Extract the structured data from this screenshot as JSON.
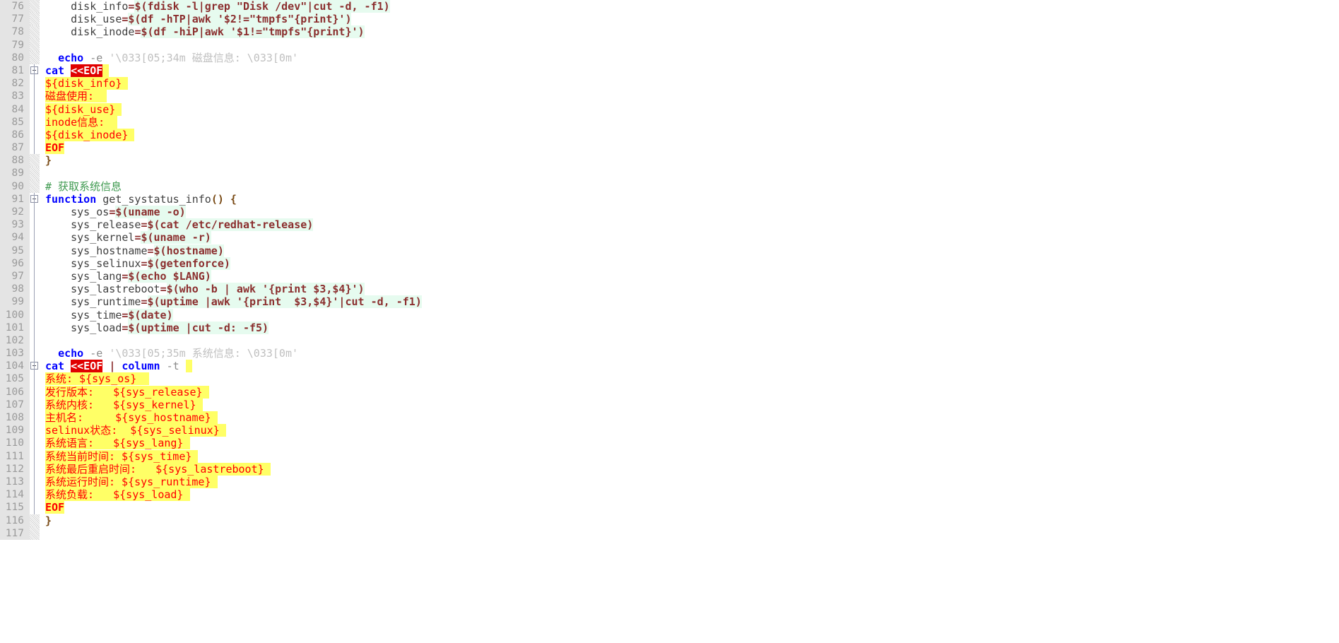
{
  "editor": {
    "app": "code-editor",
    "language": "Bash",
    "first_line": 76,
    "last_line": 117,
    "gutter_bg": "#e4e4e4",
    "gutter_fg": "#9a9a9a",
    "colors": {
      "keyword": "#0000ff",
      "operator": "#8b2e2e",
      "comment": "#3f9a50",
      "string": "#c0c0c0",
      "substitution_bg": "#e6fbef",
      "heredoc_bg": "#ffff66",
      "heredoc_fg": "#ff0000",
      "eof_marker_bg": "#e00000",
      "eof_marker_fg": "#ffffff",
      "text": "#404040"
    }
  },
  "lines": [
    {
      "n": 76,
      "fold": "hatch",
      "text": "    disk_info=$(fdisk -l|grep \"Disk /dev\"|cut -d, -f1)"
    },
    {
      "n": 77,
      "fold": "hatch",
      "text": "    disk_use=$(df -hTP|awk '$2!=\"tmpfs\"{print}')"
    },
    {
      "n": 78,
      "fold": "hatch",
      "text": "    disk_inode=$(df -hiP|awk '$1!=\"tmpfs\"{print}')"
    },
    {
      "n": 79,
      "fold": "hatch",
      "text": ""
    },
    {
      "n": 80,
      "fold": "hatch",
      "text": "  echo -e '\\033[05;34m 磁盘信息: \\033[0m'"
    },
    {
      "n": 81,
      "fold": "box",
      "text": "cat <<EOF"
    },
    {
      "n": 82,
      "fold": "guide",
      "text": "${disk_info}"
    },
    {
      "n": 83,
      "fold": "guide",
      "text": "磁盘使用:"
    },
    {
      "n": 84,
      "fold": "guide",
      "text": "${disk_use}"
    },
    {
      "n": 85,
      "fold": "guide",
      "text": "inode信息:"
    },
    {
      "n": 86,
      "fold": "guide",
      "text": "${disk_inode}"
    },
    {
      "n": 87,
      "fold": "guide",
      "text": "EOF"
    },
    {
      "n": 88,
      "fold": "hatch",
      "text": "}"
    },
    {
      "n": 89,
      "fold": "hatch",
      "text": ""
    },
    {
      "n": 90,
      "fold": "hatch",
      "text": "# 获取系统信息"
    },
    {
      "n": 91,
      "fold": "box",
      "text": "function get_systatus_info() {"
    },
    {
      "n": 92,
      "fold": "guide",
      "text": "    sys_os=$(uname -o)"
    },
    {
      "n": 93,
      "fold": "guide",
      "text": "    sys_release=$(cat /etc/redhat-release)"
    },
    {
      "n": 94,
      "fold": "guide",
      "text": "    sys_kernel=$(uname -r)"
    },
    {
      "n": 95,
      "fold": "guide",
      "text": "    sys_hostname=$(hostname)"
    },
    {
      "n": 96,
      "fold": "guide",
      "text": "    sys_selinux=$(getenforce)"
    },
    {
      "n": 97,
      "fold": "guide",
      "text": "    sys_lang=$(echo $LANG)"
    },
    {
      "n": 98,
      "fold": "guide",
      "text": "    sys_lastreboot=$(who -b | awk '{print $3,$4}')"
    },
    {
      "n": 99,
      "fold": "guide",
      "text": "    sys_runtime=$(uptime |awk '{print  $3,$4}'|cut -d, -f1)"
    },
    {
      "n": 100,
      "fold": "guide",
      "text": "    sys_time=$(date)"
    },
    {
      "n": 101,
      "fold": "guide",
      "text": "    sys_load=$(uptime |cut -d: -f5)"
    },
    {
      "n": 102,
      "fold": "guide",
      "text": ""
    },
    {
      "n": 103,
      "fold": "guide",
      "text": "  echo -e '\\033[05;35m 系统信息: \\033[0m'"
    },
    {
      "n": 104,
      "fold": "box",
      "text": "cat <<EOF | column -t "
    },
    {
      "n": 105,
      "fold": "guide",
      "text": "系统: ${sys_os}"
    },
    {
      "n": 106,
      "fold": "guide",
      "text": "发行版本:   ${sys_release}"
    },
    {
      "n": 107,
      "fold": "guide",
      "text": "系统内核:   ${sys_kernel}"
    },
    {
      "n": 108,
      "fold": "guide",
      "text": "主机名:     ${sys_hostname}"
    },
    {
      "n": 109,
      "fold": "guide",
      "text": "selinux状态:  ${sys_selinux}"
    },
    {
      "n": 110,
      "fold": "guide",
      "text": "系统语言:   ${sys_lang}"
    },
    {
      "n": 111,
      "fold": "guide",
      "text": "系统当前时间: ${sys_time}"
    },
    {
      "n": 112,
      "fold": "guide",
      "text": "系统最后重启时间:   ${sys_lastreboot}"
    },
    {
      "n": 113,
      "fold": "guide",
      "text": "系统运行时间: ${sys_runtime}"
    },
    {
      "n": 114,
      "fold": "guide",
      "text": "系统负载:   ${sys_load}"
    },
    {
      "n": 115,
      "fold": "guide",
      "text": "EOF"
    },
    {
      "n": 116,
      "fold": "hatch",
      "text": "}"
    },
    {
      "n": 117,
      "fold": "hatch",
      "text": ""
    }
  ],
  "rendered": {
    "76": [
      {
        "t": "    disk_info",
        "c": "plainid"
      },
      {
        "t": "=",
        "c": "op"
      },
      {
        "t": "$(fdisk -l|grep \"Disk /dev\"|cut -d, -f1)",
        "c": "subst"
      }
    ],
    "77": [
      {
        "t": "    disk_use",
        "c": "plainid"
      },
      {
        "t": "=",
        "c": "op"
      },
      {
        "t": "$(df -hTP|awk '$2!=\"tmpfs\"{print}')",
        "c": "subst"
      }
    ],
    "78": [
      {
        "t": "    disk_inode",
        "c": "plainid"
      },
      {
        "t": "=",
        "c": "op"
      },
      {
        "t": "$(df -hiP|awk '$1!=\"tmpfs\"{print}')",
        "c": "subst"
      }
    ],
    "79": [],
    "80": [
      {
        "t": "  ",
        "c": "plainid"
      },
      {
        "t": "echo",
        "c": "kw"
      },
      {
        "t": " ",
        "c": "plainid"
      },
      {
        "t": "-e",
        "c": "dim"
      },
      {
        "t": " ",
        "c": "plainid"
      },
      {
        "t": "'\\033[05;34m 磁盘信息: \\033[0m'",
        "c": "str"
      }
    ],
    "81": [
      {
        "t": "cat",
        "c": "kw"
      },
      {
        "t": " ",
        "c": "plainid"
      },
      {
        "t": "<<EOF",
        "c": "eofmark"
      },
      {
        "t": " ",
        "c": "hlspace"
      }
    ],
    "82": [
      {
        "t": "${disk_info}",
        "c": "heredoc"
      },
      {
        "t": " ",
        "c": "heredoc"
      }
    ],
    "83": [
      {
        "t": "磁盘使用:",
        "c": "heredoc"
      },
      {
        "t": "  ",
        "c": "heredoc"
      }
    ],
    "84": [
      {
        "t": "${disk_use}",
        "c": "heredoc"
      },
      {
        "t": " ",
        "c": "heredoc"
      }
    ],
    "85": [
      {
        "t": "inode信息:",
        "c": "heredoc"
      },
      {
        "t": "  ",
        "c": "heredoc"
      }
    ],
    "86": [
      {
        "t": "${disk_inode}",
        "c": "heredoc"
      },
      {
        "t": " ",
        "c": "heredoc"
      }
    ],
    "87": [
      {
        "t": "EOF",
        "c": "heredoc b"
      }
    ],
    "88": [
      {
        "t": "}",
        "c": "brace"
      }
    ],
    "89": [],
    "90": [
      {
        "t": "# 获取系统信息",
        "c": "cmt"
      }
    ],
    "91": [
      {
        "t": "function",
        "c": "kw"
      },
      {
        "t": " get_systatus_info",
        "c": "plainid"
      },
      {
        "t": "()",
        "c": "brace"
      },
      {
        "t": " ",
        "c": "plainid"
      },
      {
        "t": "{",
        "c": "brace"
      }
    ],
    "92": [
      {
        "t": "    sys_os",
        "c": "plainid"
      },
      {
        "t": "=",
        "c": "op"
      },
      {
        "t": "$(uname -o)",
        "c": "subst"
      }
    ],
    "93": [
      {
        "t": "    sys_release",
        "c": "plainid"
      },
      {
        "t": "=",
        "c": "op"
      },
      {
        "t": "$(cat /etc/redhat-release)",
        "c": "subst"
      }
    ],
    "94": [
      {
        "t": "    sys_kernel",
        "c": "plainid"
      },
      {
        "t": "=",
        "c": "op"
      },
      {
        "t": "$(uname -r)",
        "c": "subst"
      }
    ],
    "95": [
      {
        "t": "    sys_hostname",
        "c": "plainid"
      },
      {
        "t": "=",
        "c": "op"
      },
      {
        "t": "$(hostname)",
        "c": "subst"
      }
    ],
    "96": [
      {
        "t": "    sys_selinux",
        "c": "plainid"
      },
      {
        "t": "=",
        "c": "op"
      },
      {
        "t": "$(getenforce)",
        "c": "subst"
      }
    ],
    "97": [
      {
        "t": "    sys_lang",
        "c": "plainid"
      },
      {
        "t": "=",
        "c": "op"
      },
      {
        "t": "$(echo $LANG)",
        "c": "subst"
      }
    ],
    "98": [
      {
        "t": "    sys_lastreboot",
        "c": "plainid"
      },
      {
        "t": "=",
        "c": "op"
      },
      {
        "t": "$(who -b | awk '{print $3,$4}')",
        "c": "subst"
      }
    ],
    "99": [
      {
        "t": "    sys_runtime",
        "c": "plainid"
      },
      {
        "t": "=",
        "c": "op"
      },
      {
        "t": "$(uptime |awk '{print  $3,$4}'|cut -d, -f1)",
        "c": "subst"
      }
    ],
    "100": [
      {
        "t": "    sys_time",
        "c": "plainid"
      },
      {
        "t": "=",
        "c": "op"
      },
      {
        "t": "$(date)",
        "c": "subst"
      }
    ],
    "101": [
      {
        "t": "    sys_load",
        "c": "plainid"
      },
      {
        "t": "=",
        "c": "op"
      },
      {
        "t": "$(uptime |cut -d: -f5)",
        "c": "subst"
      }
    ],
    "102": [],
    "103": [
      {
        "t": "  ",
        "c": "plainid"
      },
      {
        "t": "echo",
        "c": "kw"
      },
      {
        "t": " ",
        "c": "plainid"
      },
      {
        "t": "-e",
        "c": "dim"
      },
      {
        "t": " ",
        "c": "plainid"
      },
      {
        "t": "'\\033[05;35m 系统信息: \\033[0m'",
        "c": "str"
      }
    ],
    "104": [
      {
        "t": "cat",
        "c": "kw"
      },
      {
        "t": " ",
        "c": "plainid"
      },
      {
        "t": "<<EOF",
        "c": "eofmark"
      },
      {
        "t": " ",
        "c": "plainid"
      },
      {
        "t": "|",
        "c": "op"
      },
      {
        "t": " ",
        "c": "plainid"
      },
      {
        "t": "column",
        "c": "kw"
      },
      {
        "t": " ",
        "c": "plainid"
      },
      {
        "t": "-t",
        "c": "dim"
      },
      {
        "t": " ",
        "c": "plainid"
      },
      {
        "t": " ",
        "c": "hlspace"
      }
    ],
    "105": [
      {
        "t": "系统: ${sys_os}",
        "c": "heredoc"
      },
      {
        "t": "  ",
        "c": "heredoc"
      }
    ],
    "106": [
      {
        "t": "发行版本:   ${sys_release}",
        "c": "heredoc"
      },
      {
        "t": " ",
        "c": "heredoc"
      }
    ],
    "107": [
      {
        "t": "系统内核:   ${sys_kernel}",
        "c": "heredoc"
      },
      {
        "t": " ",
        "c": "heredoc"
      }
    ],
    "108": [
      {
        "t": "主机名:     ${sys_hostname}",
        "c": "heredoc"
      },
      {
        "t": " ",
        "c": "heredoc"
      }
    ],
    "109": [
      {
        "t": "selinux状态:  ${sys_selinux}",
        "c": "heredoc"
      },
      {
        "t": " ",
        "c": "heredoc"
      }
    ],
    "110": [
      {
        "t": "系统语言:   ${sys_lang}",
        "c": "heredoc"
      },
      {
        "t": " ",
        "c": "heredoc"
      }
    ],
    "111": [
      {
        "t": "系统当前时间: ${sys_time}",
        "c": "heredoc"
      },
      {
        "t": " ",
        "c": "heredoc"
      }
    ],
    "112": [
      {
        "t": "系统最后重启时间:   ${sys_lastreboot}",
        "c": "heredoc"
      },
      {
        "t": " ",
        "c": "heredoc"
      }
    ],
    "113": [
      {
        "t": "系统运行时间: ${sys_runtime}",
        "c": "heredoc"
      },
      {
        "t": " ",
        "c": "heredoc"
      }
    ],
    "114": [
      {
        "t": "系统负载:   ${sys_load}",
        "c": "heredoc"
      },
      {
        "t": " ",
        "c": "heredoc"
      }
    ],
    "115": [
      {
        "t": "EOF",
        "c": "heredoc b"
      }
    ],
    "116": [
      {
        "t": "}",
        "c": "brace"
      }
    ],
    "117": [],
    "_note": "token stream per line number"
  }
}
